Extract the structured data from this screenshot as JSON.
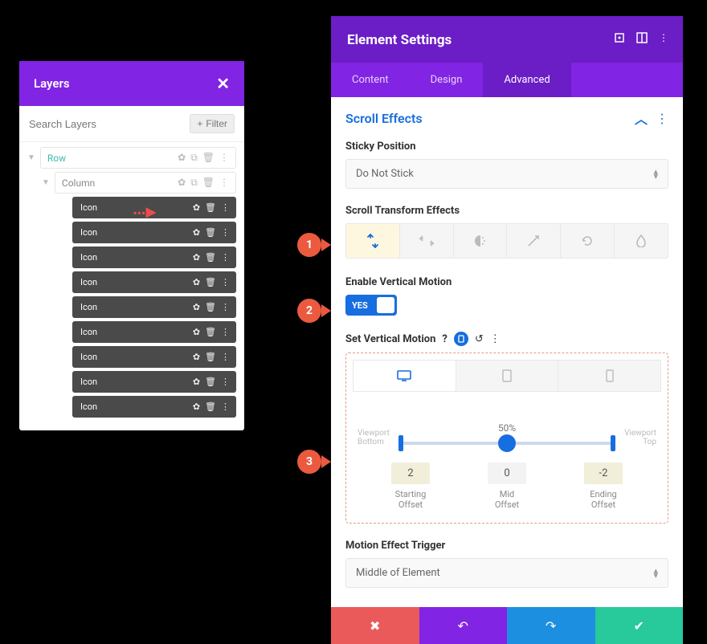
{
  "layers": {
    "title": "Layers",
    "search_placeholder": "Search Layers",
    "filter_label": "Filter",
    "tree": {
      "row_label": "Row",
      "column_label": "Column",
      "icon_label": "Icon",
      "icon_count": 9
    }
  },
  "settings": {
    "title": "Element Settings",
    "tabs": {
      "content": "Content",
      "design": "Design",
      "advanced": "Advanced"
    },
    "section_title": "Scroll Effects",
    "sticky": {
      "label": "Sticky Position",
      "value": "Do Not Stick"
    },
    "transform": {
      "label": "Scroll Transform Effects"
    },
    "enable_vm": {
      "label": "Enable Vertical Motion",
      "toggle": "YES"
    },
    "set_vm": {
      "label": "Set Vertical Motion",
      "percent": "50%",
      "vp_bottom": "Viewport\nBottom",
      "vp_top": "Viewport\nTop",
      "start_val": "2",
      "mid_val": "0",
      "end_val": "-2",
      "start_lbl": "Starting\nOffset",
      "mid_lbl": "Mid\nOffset",
      "end_lbl": "Ending\nOffset"
    },
    "trigger": {
      "label": "Motion Effect Trigger",
      "value": "Middle of Element"
    }
  },
  "annotations": {
    "a1": "1",
    "a2": "2",
    "a3": "3"
  }
}
